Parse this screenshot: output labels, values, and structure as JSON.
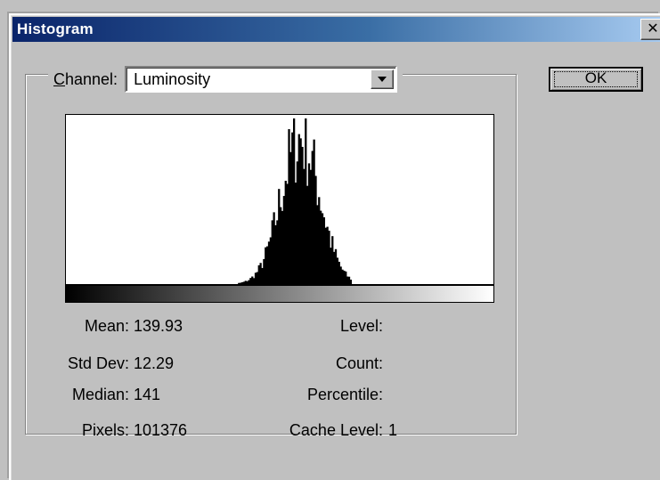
{
  "window": {
    "title": "Histogram",
    "close_glyph": "✕"
  },
  "channel": {
    "label_prefix": "",
    "label_underlined": "C",
    "label_rest": "hannel:",
    "value": "Luminosity"
  },
  "ok_button": {
    "label": "OK"
  },
  "stats": {
    "mean": {
      "label": "Mean:",
      "value": "139.93"
    },
    "std_dev": {
      "label": "Std Dev:",
      "value": "12.29"
    },
    "median": {
      "label": "Median:",
      "value": "141"
    },
    "pixels": {
      "label": "Pixels:",
      "value": "101376"
    },
    "level": {
      "label": "Level:",
      "value": ""
    },
    "count": {
      "label": "Count:",
      "value": ""
    },
    "percentile": {
      "label": "Percentile:",
      "value": ""
    },
    "cache_level": {
      "label": "Cache Level:",
      "value": "1"
    }
  },
  "chart_data": {
    "type": "bar",
    "x_range": [
      0,
      255
    ],
    "y_range": [
      0,
      1
    ],
    "gradient": [
      "#000000",
      "#ffffff"
    ],
    "mean": 139.93,
    "std_dev": 12.29,
    "median": 141,
    "peak_level": 141,
    "visible_range": [
      95,
      170
    ]
  }
}
